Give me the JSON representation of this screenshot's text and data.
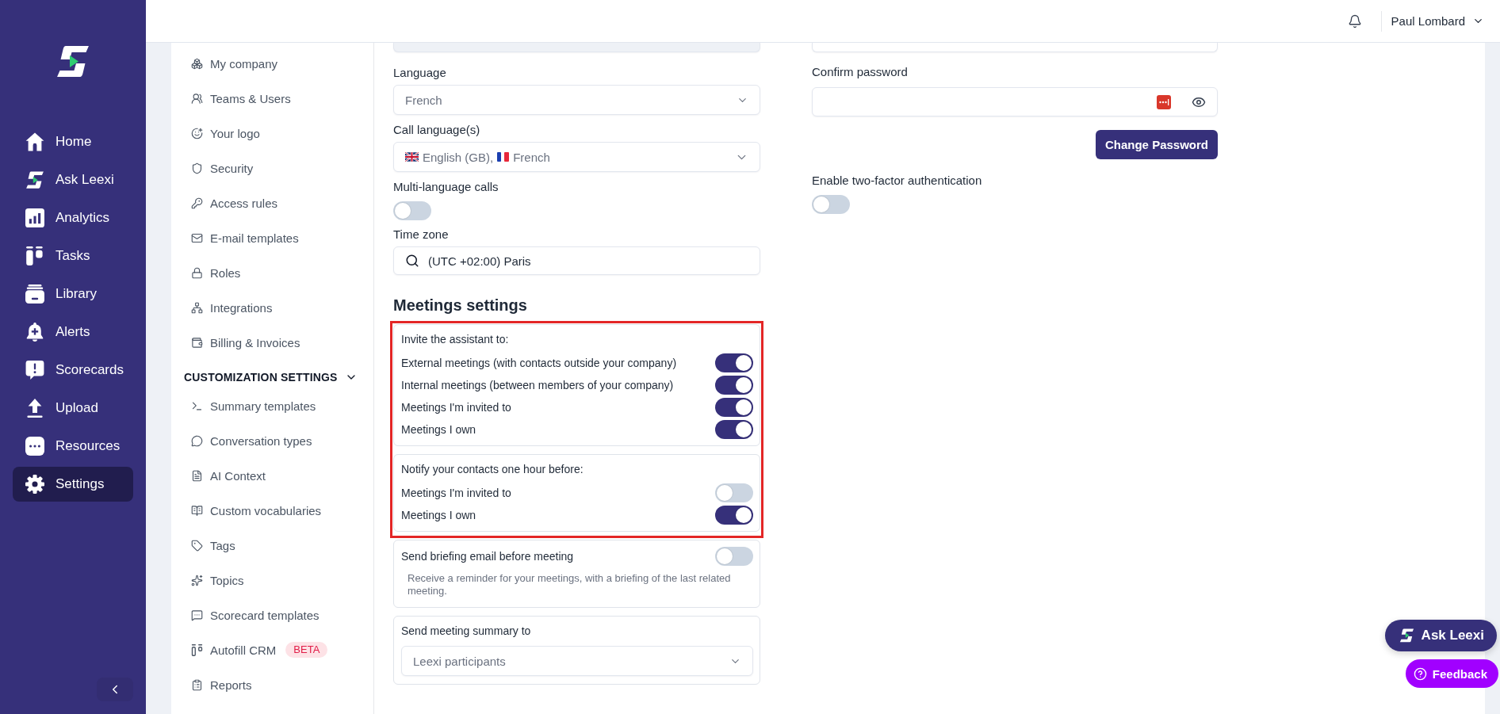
{
  "sidebar": {
    "items": [
      {
        "label": "Home",
        "selected": false
      },
      {
        "label": "Ask Leexi",
        "selected": false
      },
      {
        "label": "Analytics",
        "selected": false
      },
      {
        "label": "Tasks",
        "selected": false
      },
      {
        "label": "Library",
        "selected": false
      },
      {
        "label": "Alerts",
        "selected": false
      },
      {
        "label": "Scorecards",
        "selected": false
      },
      {
        "label": "Upload",
        "selected": false
      },
      {
        "label": "Resources",
        "selected": false
      },
      {
        "label": "Settings",
        "selected": true
      }
    ]
  },
  "header": {
    "user_name": "Paul Lombard"
  },
  "settings_nav": {
    "items": [
      {
        "label": "My company",
        "selected": false
      },
      {
        "label": "Teams & Users",
        "selected": false
      },
      {
        "label": "Your logo",
        "selected": false
      },
      {
        "label": "Security",
        "selected": false
      },
      {
        "label": "Access rules",
        "selected": false
      },
      {
        "label": "E-mail templates",
        "selected": false
      },
      {
        "label": "Roles",
        "selected": false
      },
      {
        "label": "Integrations",
        "selected": false
      },
      {
        "label": "Billing & Invoices",
        "selected": false
      }
    ],
    "section": {
      "title": "CUSTOMIZATION SETTINGS",
      "expanded": true,
      "items": [
        {
          "label": "Summary templates",
          "selected": false
        },
        {
          "label": "Conversation types",
          "selected": false
        },
        {
          "label": "AI Context",
          "selected": false
        },
        {
          "label": "Custom vocabularies",
          "selected": false
        },
        {
          "label": "Tags",
          "selected": false
        },
        {
          "label": "Topics",
          "selected": false
        },
        {
          "label": "Scorecard templates",
          "selected": false
        },
        {
          "label": "Autofill CRM",
          "badge": "BETA",
          "selected": false
        },
        {
          "label": "Reports",
          "selected": false
        }
      ]
    }
  },
  "profile_form": {
    "language": {
      "label": "Language",
      "value": "French"
    },
    "call_languages": {
      "label": "Call language(s)",
      "values": [
        "English (GB),",
        "French"
      ]
    },
    "multi_language_calls": {
      "label": "Multi-language calls",
      "on": false
    },
    "time_zone": {
      "label": "Time zone",
      "value": "(UTC +02:00) Paris"
    }
  },
  "meetings_settings": {
    "title": "Meetings settings",
    "highlight": true,
    "invite_assistant": {
      "title": "Invite the assistant to:",
      "options": [
        {
          "label": "External meetings (with contacts outside your company)",
          "on": true
        },
        {
          "label": "Internal meetings (between members of your company)",
          "on": true
        },
        {
          "label": "Meetings I'm invited to",
          "on": true
        },
        {
          "label": "Meetings I own",
          "on": true
        }
      ]
    },
    "notify_contacts": {
      "title": "Notify your contacts one hour before:",
      "options": [
        {
          "label": "Meetings I'm invited to",
          "on": false
        },
        {
          "label": "Meetings I own",
          "on": true
        }
      ]
    },
    "briefing_email": {
      "label": "Send briefing email before meeting",
      "on": false,
      "description": "Receive a reminder for your meetings, with a briefing of the last related meeting."
    },
    "meeting_summary": {
      "label": "Send meeting summary to",
      "value": "Leexi participants"
    }
  },
  "security_form": {
    "confirm_password": {
      "label": "Confirm password"
    },
    "change_password_button": "Change Password",
    "two_factor": {
      "label": "Enable two-factor authentication",
      "on": false
    }
  },
  "floating_buttons": {
    "ask": "Ask Leexi",
    "feedback": "Feedback"
  }
}
